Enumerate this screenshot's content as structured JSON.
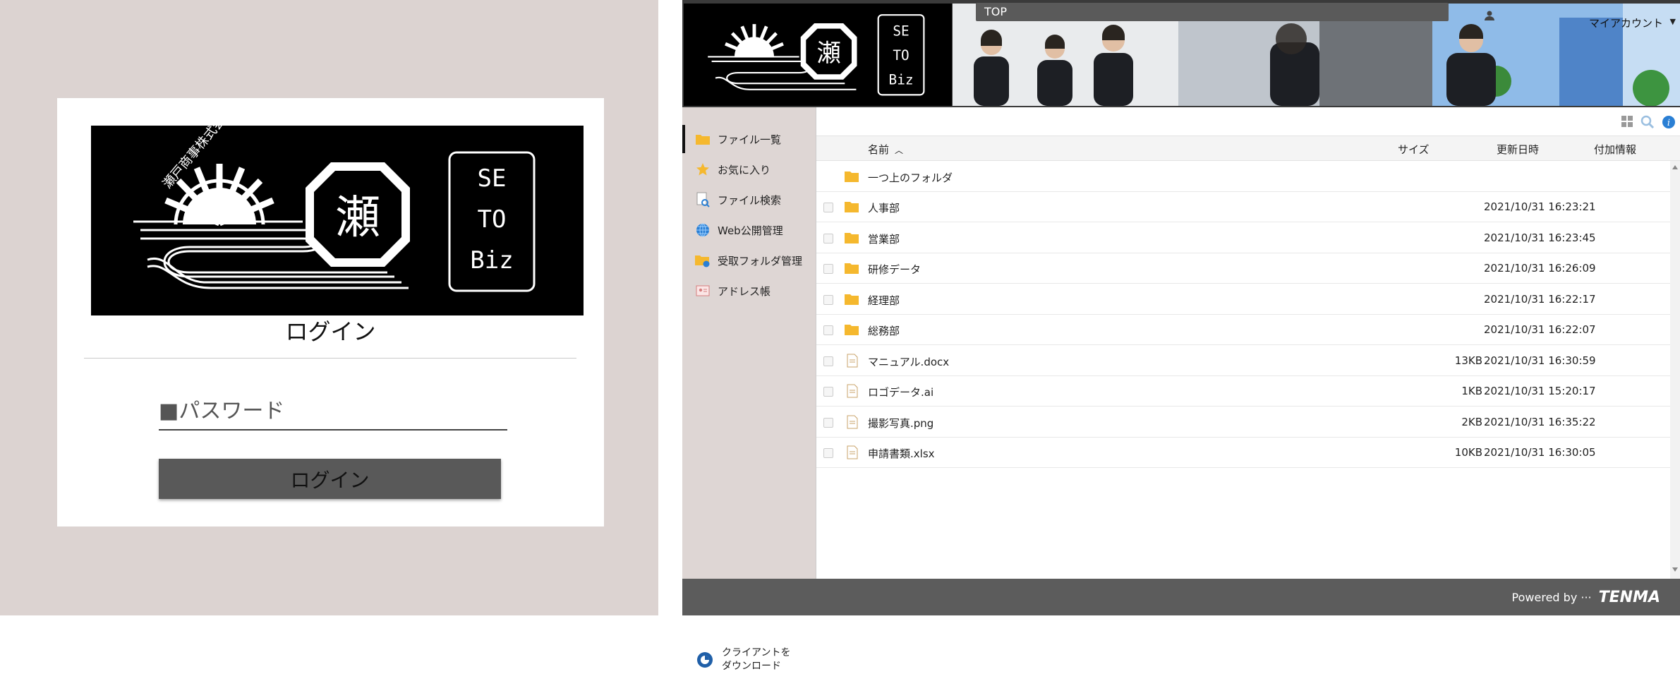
{
  "login": {
    "logo_text": [
      "SE",
      "TO",
      "Biz"
    ],
    "logo_kanji": "瀬",
    "logo_arc_text": "瀬戸商事株式会社",
    "title": "ログイン",
    "password_placeholder": "■パスワード",
    "button_label": "ログイン"
  },
  "app": {
    "header": {
      "tab_label": "TOP",
      "account_label": "マイアカウント"
    },
    "sidebar": {
      "items": [
        {
          "label": "ファイル一覧",
          "icon": "folder-icon",
          "active": true
        },
        {
          "label": "お気に入り",
          "icon": "star-icon"
        },
        {
          "label": "ファイル検索",
          "icon": "file-search-icon"
        },
        {
          "label": "Web公開管理",
          "icon": "globe-icon"
        },
        {
          "label": "受取フォルダ管理",
          "icon": "receive-folder-icon"
        },
        {
          "label": "アドレス帳",
          "icon": "address-book-icon"
        }
      ],
      "client_download": [
        "クライアントを",
        "ダウンロード"
      ]
    },
    "table": {
      "columns": {
        "name": "名前",
        "size": "サイズ",
        "modified": "更新日時",
        "info": "付加情報"
      },
      "parent_folder": "一つ上のフォルダ",
      "rows": [
        {
          "type": "folder",
          "name": "人事部",
          "size": "",
          "modified": "2021/10/31 16:23:21"
        },
        {
          "type": "folder",
          "name": "営業部",
          "size": "",
          "modified": "2021/10/31 16:23:45"
        },
        {
          "type": "folder",
          "name": "研修データ",
          "size": "",
          "modified": "2021/10/31 16:26:09"
        },
        {
          "type": "folder",
          "name": "経理部",
          "size": "",
          "modified": "2021/10/31 16:22:17"
        },
        {
          "type": "folder",
          "name": "総務部",
          "size": "",
          "modified": "2021/10/31 16:22:07"
        },
        {
          "type": "file",
          "name": "マニュアル.docx",
          "size": "13KB",
          "modified": "2021/10/31 16:30:59"
        },
        {
          "type": "file",
          "name": "ロゴデータ.ai",
          "size": "1KB",
          "modified": "2021/10/31 15:20:17"
        },
        {
          "type": "file",
          "name": "撮影写真.png",
          "size": "2KB",
          "modified": "2021/10/31 16:35:22"
        },
        {
          "type": "file",
          "name": "申請書類.xlsx",
          "size": "10KB",
          "modified": "2021/10/31 16:30:05"
        }
      ]
    },
    "footer": {
      "powered_by": "Powered by ···",
      "brand": "TENMA"
    },
    "colors": {
      "folder": "#f5b82e",
      "info": "#2a7fd4",
      "footer": "#5c5c5c",
      "sidebar": "#ded6d4"
    }
  }
}
